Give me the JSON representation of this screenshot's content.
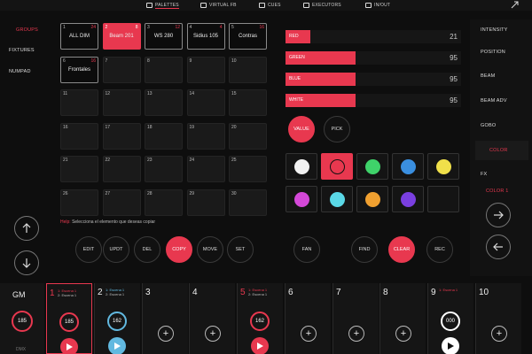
{
  "topbar": {
    "tabs": [
      {
        "label": "PALETTES",
        "icon": "palette-icon",
        "active": true
      },
      {
        "label": "VIRTUAL FB",
        "icon": "sliders-icon",
        "active": false
      },
      {
        "label": "CUES",
        "icon": "cues-icon",
        "active": false
      },
      {
        "label": "EXECUTORS",
        "icon": "grid-icon",
        "active": false
      },
      {
        "label": "IN/OUT",
        "icon": "inout-icon",
        "active": false
      }
    ],
    "corner_icon": "expand-icon"
  },
  "left_sidebar": {
    "items": [
      {
        "label": "GROUPS",
        "active": true
      },
      {
        "label": "FIXTURES",
        "active": false
      },
      {
        "label": "NUMPAD",
        "active": false
      }
    ]
  },
  "right_sidebar": {
    "items": [
      {
        "label": "INTENSITY",
        "active": false
      },
      {
        "label": "POSITION",
        "active": false
      },
      {
        "label": "BEAM",
        "active": false
      },
      {
        "label": "BEAM ADV",
        "active": false
      },
      {
        "label": "GOBO",
        "active": false
      },
      {
        "label": "COLOR",
        "active": true
      },
      {
        "label": "FX",
        "active": false
      }
    ],
    "sub_label": "COLOR 1"
  },
  "groups_grid": {
    "cells": [
      {
        "num": "1",
        "count": "24",
        "name": "ALL DIM",
        "state": "filled"
      },
      {
        "num": "2",
        "count": "8",
        "name": "Beam 201",
        "state": "selected"
      },
      {
        "num": "3",
        "count": "12",
        "name": "WS 280",
        "state": "filled"
      },
      {
        "num": "4",
        "count": "4",
        "name": "Sidius 105",
        "state": "filled"
      },
      {
        "num": "5",
        "count": "16",
        "name": "Contras",
        "state": "filled"
      },
      {
        "num": "6",
        "count": "16",
        "name": "Frontales",
        "state": "filled"
      },
      {
        "num": "7",
        "count": "",
        "name": "",
        "state": "empty"
      },
      {
        "num": "8",
        "count": "",
        "name": "",
        "state": "empty"
      },
      {
        "num": "9",
        "count": "",
        "name": "",
        "state": "empty"
      },
      {
        "num": "10",
        "count": "",
        "name": "",
        "state": "empty"
      },
      {
        "num": "11",
        "count": "",
        "name": "",
        "state": "empty"
      },
      {
        "num": "12",
        "count": "",
        "name": "",
        "state": "empty"
      },
      {
        "num": "13",
        "count": "",
        "name": "",
        "state": "empty"
      },
      {
        "num": "14",
        "count": "",
        "name": "",
        "state": "empty"
      },
      {
        "num": "15",
        "count": "",
        "name": "",
        "state": "empty"
      },
      {
        "num": "16",
        "count": "",
        "name": "",
        "state": "empty"
      },
      {
        "num": "17",
        "count": "",
        "name": "",
        "state": "empty"
      },
      {
        "num": "18",
        "count": "",
        "name": "",
        "state": "empty"
      },
      {
        "num": "19",
        "count": "",
        "name": "",
        "state": "empty"
      },
      {
        "num": "20",
        "count": "",
        "name": "",
        "state": "empty"
      },
      {
        "num": "21",
        "count": "",
        "name": "",
        "state": "empty"
      },
      {
        "num": "22",
        "count": "",
        "name": "",
        "state": "empty"
      },
      {
        "num": "23",
        "count": "",
        "name": "",
        "state": "empty"
      },
      {
        "num": "24",
        "count": "",
        "name": "",
        "state": "empty"
      },
      {
        "num": "25",
        "count": "",
        "name": "",
        "state": "empty"
      },
      {
        "num": "26",
        "count": "",
        "name": "",
        "state": "empty"
      },
      {
        "num": "27",
        "count": "",
        "name": "",
        "state": "empty"
      },
      {
        "num": "28",
        "count": "",
        "name": "",
        "state": "empty"
      },
      {
        "num": "29",
        "count": "",
        "name": "",
        "state": "empty"
      },
      {
        "num": "30",
        "count": "",
        "name": "",
        "state": "empty"
      }
    ]
  },
  "help": {
    "label": "Help:",
    "text": "Selecciona el elemento que deseas copiar"
  },
  "actions": [
    {
      "label": "EDIT",
      "active": false
    },
    {
      "label": "UPDT",
      "active": false
    },
    {
      "label": "DEL",
      "active": false
    },
    {
      "label": "COPY",
      "active": true
    },
    {
      "label": "MOVE",
      "active": false
    },
    {
      "label": "SET",
      "active": false
    }
  ],
  "right_actions": [
    {
      "label": "FAN",
      "active": false
    },
    {
      "label": "FIND",
      "active": false
    },
    {
      "label": "CLEAR",
      "active": true
    },
    {
      "label": "REC",
      "active": false
    }
  ],
  "faders": [
    {
      "label": "RED",
      "value": "21",
      "level": 0.14
    },
    {
      "label": "GREEN",
      "value": "95",
      "level": 0.4
    },
    {
      "label": "BLUE",
      "value": "95",
      "level": 0.4
    },
    {
      "label": "WHITE",
      "value": "95",
      "level": 0.4
    }
  ],
  "mode_buttons": [
    {
      "label": "VALUE",
      "active": true
    },
    {
      "label": "PICK",
      "active": false
    }
  ],
  "swatches": [
    {
      "color": "#f2f2f2",
      "selected": false
    },
    {
      "color": "#e8384f",
      "selected": true
    },
    {
      "color": "#3fd26a",
      "selected": false
    },
    {
      "color": "#3a8fe0",
      "selected": false
    },
    {
      "color": "#f0e04a",
      "selected": false
    },
    {
      "color": "#d448d8",
      "selected": false
    },
    {
      "color": "#5ad8e6",
      "selected": false
    },
    {
      "color": "#f0a030",
      "selected": false
    },
    {
      "color": "#7a3fe0",
      "selected": false
    },
    {
      "color": "",
      "selected": false
    }
  ],
  "gm": {
    "label": "GM",
    "value": "185",
    "sub": "DMX"
  },
  "playbacks": [
    {
      "num": "1",
      "line1": "1: Escena 1",
      "line2": "2: Escena 1",
      "active": true,
      "knob": "185",
      "knob_color": "#e8384f",
      "play_color": "#e8384f"
    },
    {
      "num": "2",
      "line1": "1: Escena 1",
      "line2": "2: Escena 1",
      "active": false,
      "knob": "162",
      "knob_color": "#62b9e0",
      "play_color": "#62b9e0"
    },
    {
      "num": "3",
      "line1": "",
      "line2": "",
      "active": false,
      "knob": "",
      "knob_color": "",
      "play_color": ""
    },
    {
      "num": "4",
      "line1": "",
      "line2": "",
      "active": false,
      "knob": "",
      "knob_color": "",
      "play_color": ""
    },
    {
      "num": "5",
      "line1": "1: Escena 1",
      "line2": "2: Escena 1",
      "active": false,
      "knob": "162",
      "knob_color": "#e8384f",
      "play_color": "#e8384f"
    },
    {
      "num": "6",
      "line1": "",
      "line2": "",
      "active": false,
      "knob": "",
      "knob_color": "",
      "play_color": ""
    },
    {
      "num": "7",
      "line1": "",
      "line2": "",
      "active": false,
      "knob": "",
      "knob_color": "",
      "play_color": ""
    },
    {
      "num": "8",
      "line1": "",
      "line2": "",
      "active": false,
      "knob": "",
      "knob_color": "",
      "play_color": ""
    },
    {
      "num": "9",
      "line1": "1: Escena 1",
      "line2": "",
      "active": false,
      "knob": "000",
      "knob_color": "#ffffff",
      "play_color": "#ffffff"
    },
    {
      "num": "10",
      "line1": "",
      "line2": "",
      "active": false,
      "knob": "",
      "knob_color": "",
      "play_color": ""
    }
  ],
  "colors": {
    "accent": "#e8384f",
    "bg": "#0e0e0e",
    "cell": "#1a1a1a"
  }
}
